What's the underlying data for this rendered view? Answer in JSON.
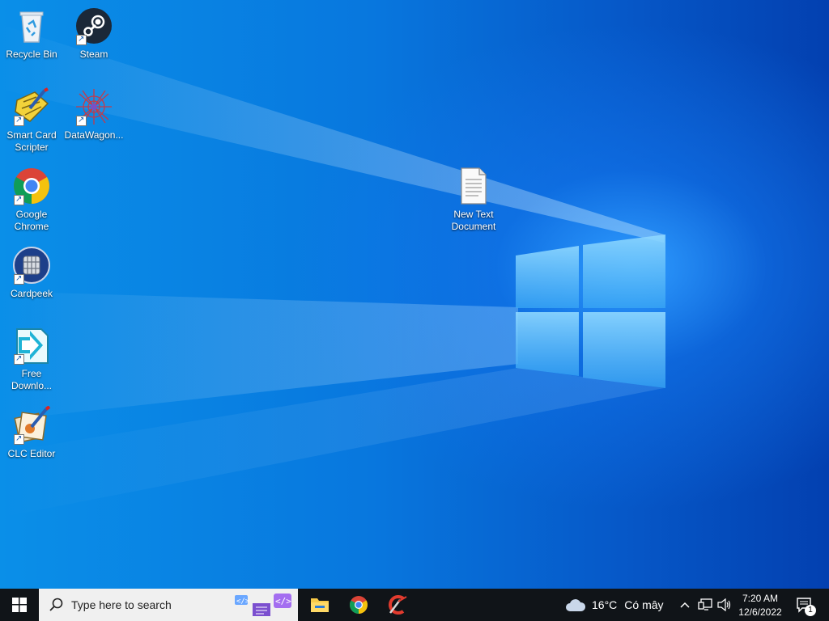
{
  "desktop_icons": [
    {
      "id": "recycle-bin",
      "label": "Recycle Bin"
    },
    {
      "id": "steam",
      "label": "Steam"
    },
    {
      "id": "smart-card-scripter",
      "label": "Smart Card Scripter"
    },
    {
      "id": "datawagon",
      "label": "DataWagon..."
    },
    {
      "id": "google-chrome",
      "label": "Google Chrome"
    },
    {
      "id": "new-text-document",
      "label": "New Text Document"
    },
    {
      "id": "cardpeek",
      "label": "Cardpeek"
    },
    {
      "id": "free-download",
      "label": "Free Downlo..."
    },
    {
      "id": "clc-editor",
      "label": "CLC Editor"
    }
  ],
  "taskbar": {
    "search_placeholder": "Type here to search",
    "pinned": [
      "File Explorer",
      "Google Chrome",
      "CCleaner"
    ],
    "weather": {
      "temperature": "16°C",
      "condition": "Có mây"
    },
    "clock": {
      "time": "7:20 AM",
      "date": "12/6/2022"
    },
    "notification_count": "1"
  },
  "colors": {
    "accent": "#0078d7",
    "taskbar": "#101418"
  }
}
